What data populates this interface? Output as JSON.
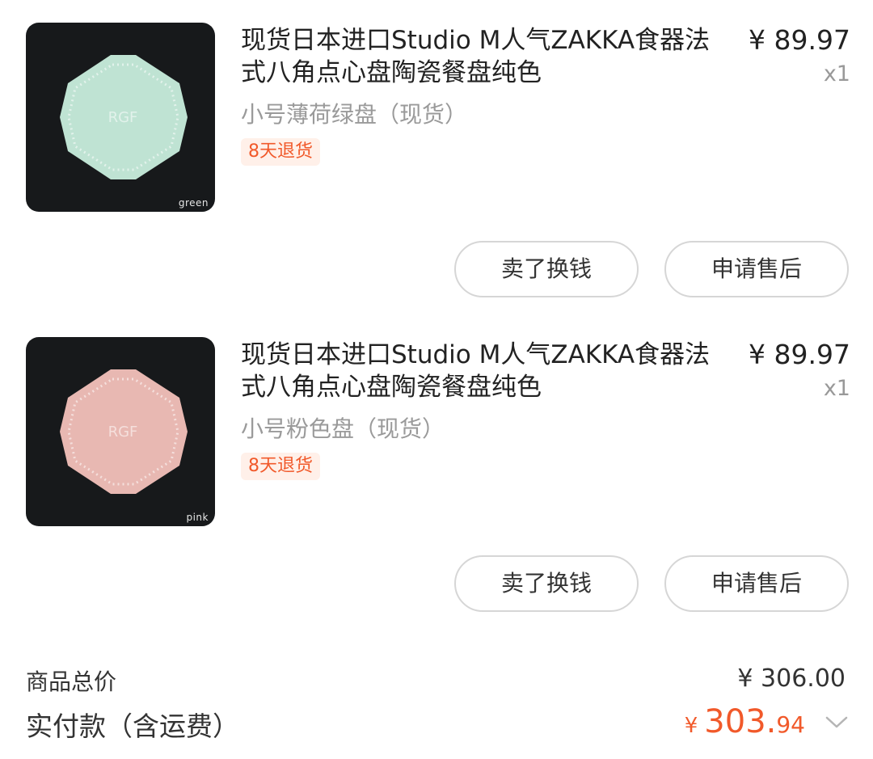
{
  "items": [
    {
      "title": "现货日本进口Studio M人气ZAKKA食器法式八角点心盘陶瓷餐盘纯色",
      "variant": "小号薄荷绿盘（现货）",
      "badge": "8天退货",
      "price": "¥ 89.97",
      "qty": "x1",
      "thumb_caption": "green",
      "thumb_color": "#bfe3d3",
      "buttons": {
        "sell": "卖了换钱",
        "after_sale": "申请售后"
      }
    },
    {
      "title": "现货日本进口Studio M人气ZAKKA食器法式八角点心盘陶瓷餐盘纯色",
      "variant": "小号粉色盘（现货）",
      "badge": "8天退货",
      "price": "¥ 89.97",
      "qty": "x1",
      "thumb_caption": "pink",
      "thumb_color": "#e8b8b2",
      "buttons": {
        "sell": "卖了换钱",
        "after_sale": "申请售后"
      }
    }
  ],
  "summary": {
    "goods_total_label": "商品总价",
    "goods_total_value": "¥ 306.00",
    "paid_label": "实付款（含运费）",
    "paid_currency": "¥",
    "paid_int": "303.",
    "paid_dec": "94"
  },
  "colors": {
    "accent": "#f1592a",
    "badge_bg": "#fff0e9",
    "text": "#222222",
    "muted": "#9a9a9a"
  },
  "icons": [
    "expand-chevron-icon"
  ]
}
